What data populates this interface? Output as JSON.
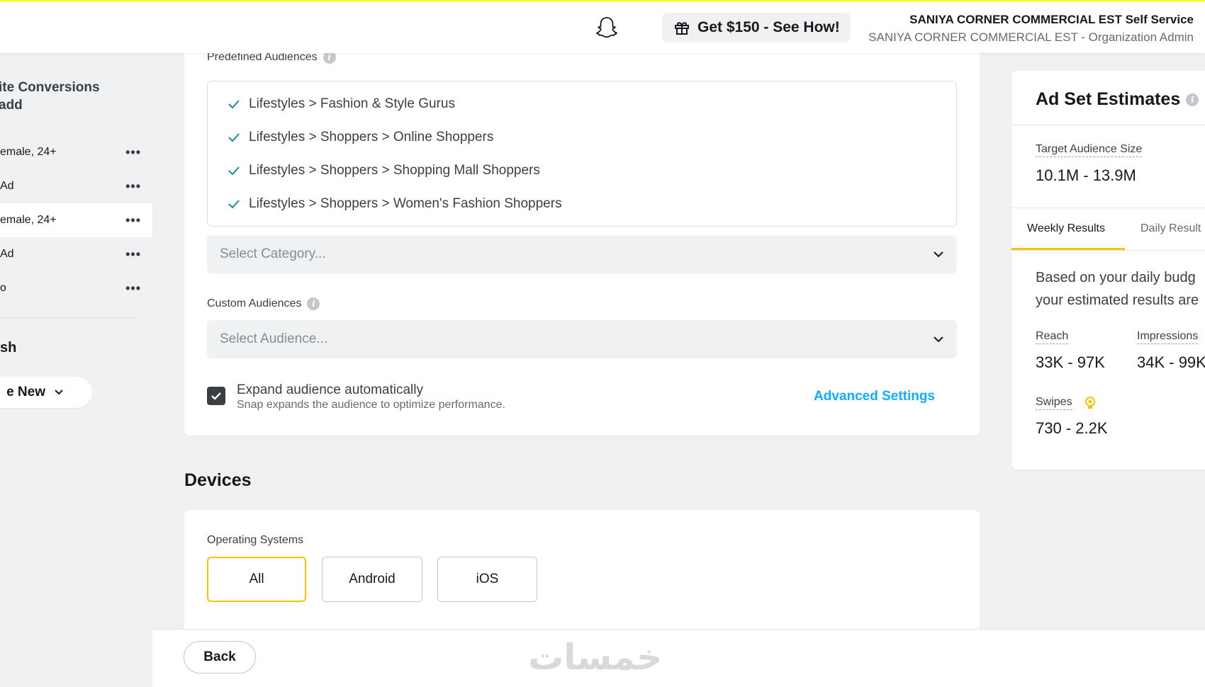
{
  "header": {
    "promo_label": "Get $150 - See How!",
    "org_title": "SANIYA CORNER COMMERCIAL EST Self Service",
    "org_subtitle": "SANIYA CORNER COMMERCIAL EST - Organization Admin"
  },
  "sidebar": {
    "title_line1": "ite Conversions",
    "title_line2": "add",
    "items": [
      {
        "label": "emale, 24+"
      },
      {
        "label": "Ad"
      },
      {
        "label": "emale, 24+"
      },
      {
        "label": "Ad"
      },
      {
        "label": "o"
      }
    ],
    "more_label": "•••",
    "section_text": "sh",
    "create_label": "e New"
  },
  "audiences": {
    "predefined_label": "Predefined Audiences",
    "selected": [
      "Lifestyles > Fashion & Style Gurus",
      "Lifestyles > Shoppers > Online Shoppers",
      "Lifestyles > Shoppers > Shopping Mall Shoppers",
      "Lifestyles > Shoppers > Women's Fashion Shoppers"
    ],
    "category_placeholder": "Select Category...",
    "custom_label": "Custom Audiences",
    "audience_placeholder": "Select Audience...",
    "expand_title": "Expand audience automatically",
    "expand_subtitle": "Snap expands the audience to optimize performance.",
    "expand_checked": true,
    "advanced_label": "Advanced Settings"
  },
  "devices": {
    "section_title": "Devices",
    "os_label": "Operating Systems",
    "os_options": [
      "All",
      "Android",
      "iOS"
    ],
    "os_selected": "All"
  },
  "estimates": {
    "title": "Ad Set Estimates",
    "audience_size_label": "Target Audience Size",
    "audience_size_value": "10.1M - 13.9M",
    "tabs": [
      "Weekly Results",
      "Daily Result"
    ],
    "active_tab": "Weekly Results",
    "desc_line1": "Based on your daily budg",
    "desc_line2": "your estimated results are",
    "reach_label": "Reach",
    "reach_value": "33K - 97K",
    "impressions_label": "Impressions",
    "impressions_value": "34K - 99K",
    "swipes_label": "Swipes",
    "swipes_value": "730 - 2.2K"
  },
  "footer": {
    "back_label": "Back",
    "watermark": "خمسات"
  },
  "colors": {
    "accent_yellow": "#fffc00",
    "selected_border": "#f5c400",
    "link_blue": "#0fadff",
    "check_teal": "#1b8aa0"
  }
}
